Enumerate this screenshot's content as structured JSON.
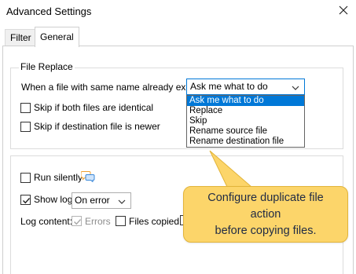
{
  "window": {
    "title": "Advanced Settings"
  },
  "tabs": [
    {
      "label": "Filter"
    },
    {
      "label": "General"
    }
  ],
  "file_replace": {
    "legend": "File Replace",
    "prompt_label": "When a file with same name already exists:",
    "selected": "Ask me what to do",
    "options": [
      "Ask me what to do",
      "Replace",
      "Skip",
      "Rename source file",
      "Rename destination file"
    ],
    "skip_identical_label": "Skip if both files are identical",
    "skip_newer_label": "Skip if destination file is newer"
  },
  "log": {
    "run_silently_label": "Run silently",
    "show_log_label": "Show log",
    "show_log_checked": true,
    "show_log_option": "On error",
    "log_content_label": "Log content:",
    "errors_label": "Errors",
    "files_copied_label": "Files copied"
  },
  "tooltip": {
    "line1": "Configure duplicate file action",
    "line2": "before copying files."
  },
  "colors": {
    "accent": "#0078d7",
    "tooltip_bg": "#fcd56a",
    "tooltip_text": "#1f2a44"
  }
}
